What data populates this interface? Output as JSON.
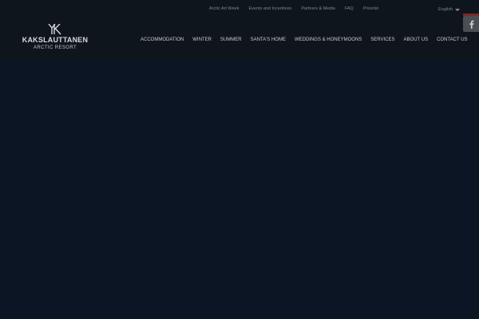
{
  "brand": {
    "name": "KAKSLAUTTANEN",
    "subtitle": "ARCTIC RESORT",
    "logo_icon": "yk-monogram-icon"
  },
  "top_links": [
    {
      "label": "Arctic Art Week"
    },
    {
      "label": "Events and Incentives"
    },
    {
      "label": "Partners & Media"
    },
    {
      "label": "FAQ"
    },
    {
      "label": "Pricelist"
    }
  ],
  "language": {
    "selected": "English",
    "icon": "caret-down-icon"
  },
  "main_nav": [
    {
      "label": "ACCOMMODATION"
    },
    {
      "label": "WINTER"
    },
    {
      "label": "SUMMER"
    },
    {
      "label": "SANTA'S HOME"
    },
    {
      "label": "WEDDINGS & HONEYMOONS"
    },
    {
      "label": "SERVICES"
    },
    {
      "label": "ABOUT US"
    },
    {
      "label": "CONTACT US"
    }
  ],
  "social": {
    "facebook_icon": "facebook-icon"
  },
  "colors": {
    "header_bg": "#0f151d",
    "hero_bg": "#0b1524",
    "nav_text": "#c9ccd0",
    "top_link_text": "#7f858b",
    "share_accent": "#7a2a24",
    "social_button_bg": "#4b4f54"
  }
}
